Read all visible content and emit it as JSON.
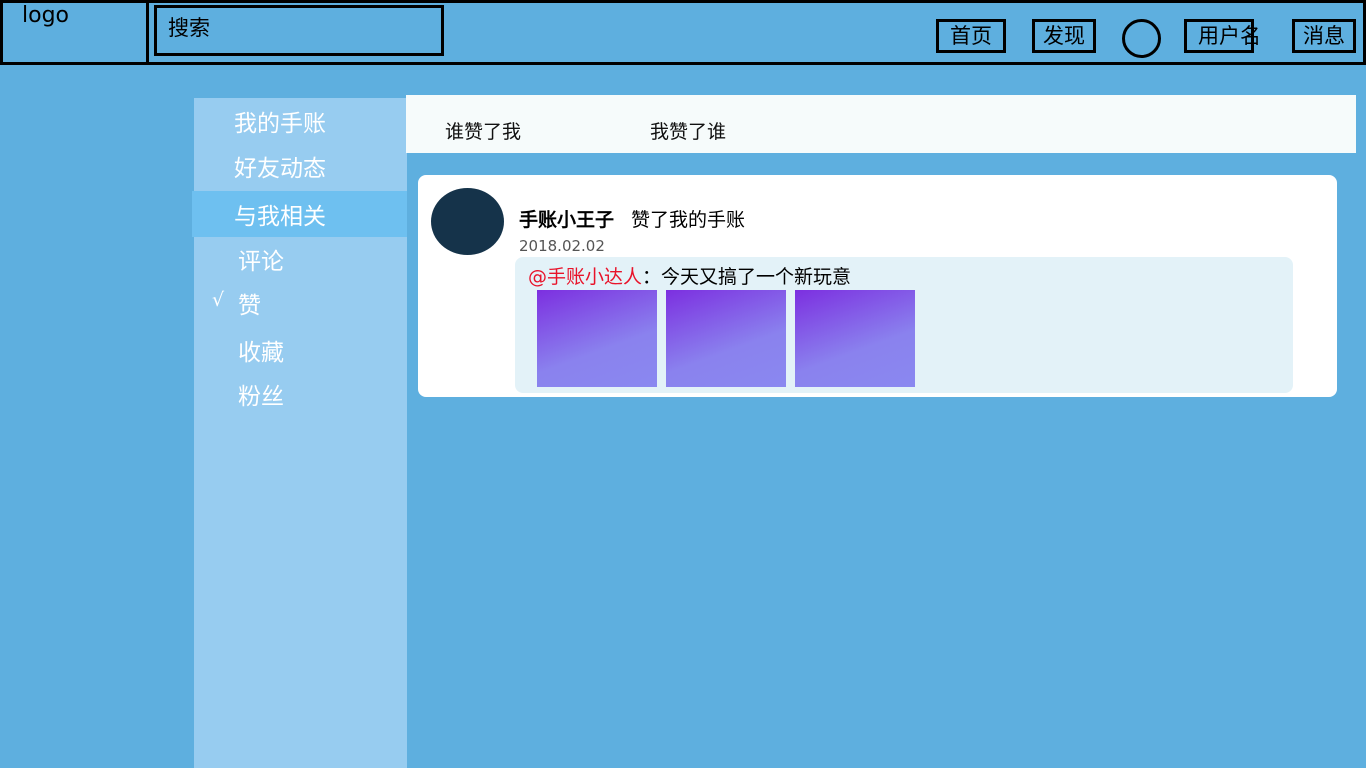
{
  "header": {
    "logo": "logo",
    "search_label": "搜索",
    "nav": {
      "home": "首页",
      "discover": "发现",
      "username": "用户名",
      "messages": "消息"
    }
  },
  "sidebar": {
    "items": [
      {
        "label": "我的手账"
      },
      {
        "label": "好友动态"
      },
      {
        "label": "与我相关",
        "active": true
      },
      {
        "label": "评论"
      },
      {
        "label": "赞",
        "checked": true,
        "check_mark": "√"
      },
      {
        "label": "收藏"
      },
      {
        "label": "粉丝"
      }
    ]
  },
  "tabs": [
    {
      "label": "谁赞了我"
    },
    {
      "label": "我赞了谁"
    }
  ],
  "feed": [
    {
      "user": "手账小王子",
      "action": "赞了我的手账",
      "date": "2018.02.02",
      "quote": {
        "mention": "@手账小达人",
        "separator": "：",
        "text": "今天又搞了一个新玩意"
      },
      "image_count": 3
    }
  ],
  "colors": {
    "background": "#5eafdf",
    "sidebar": "#97ccf0",
    "sidebar_active": "#6ec0f0",
    "mention": "#e8132a",
    "avatar": "#15334a"
  }
}
